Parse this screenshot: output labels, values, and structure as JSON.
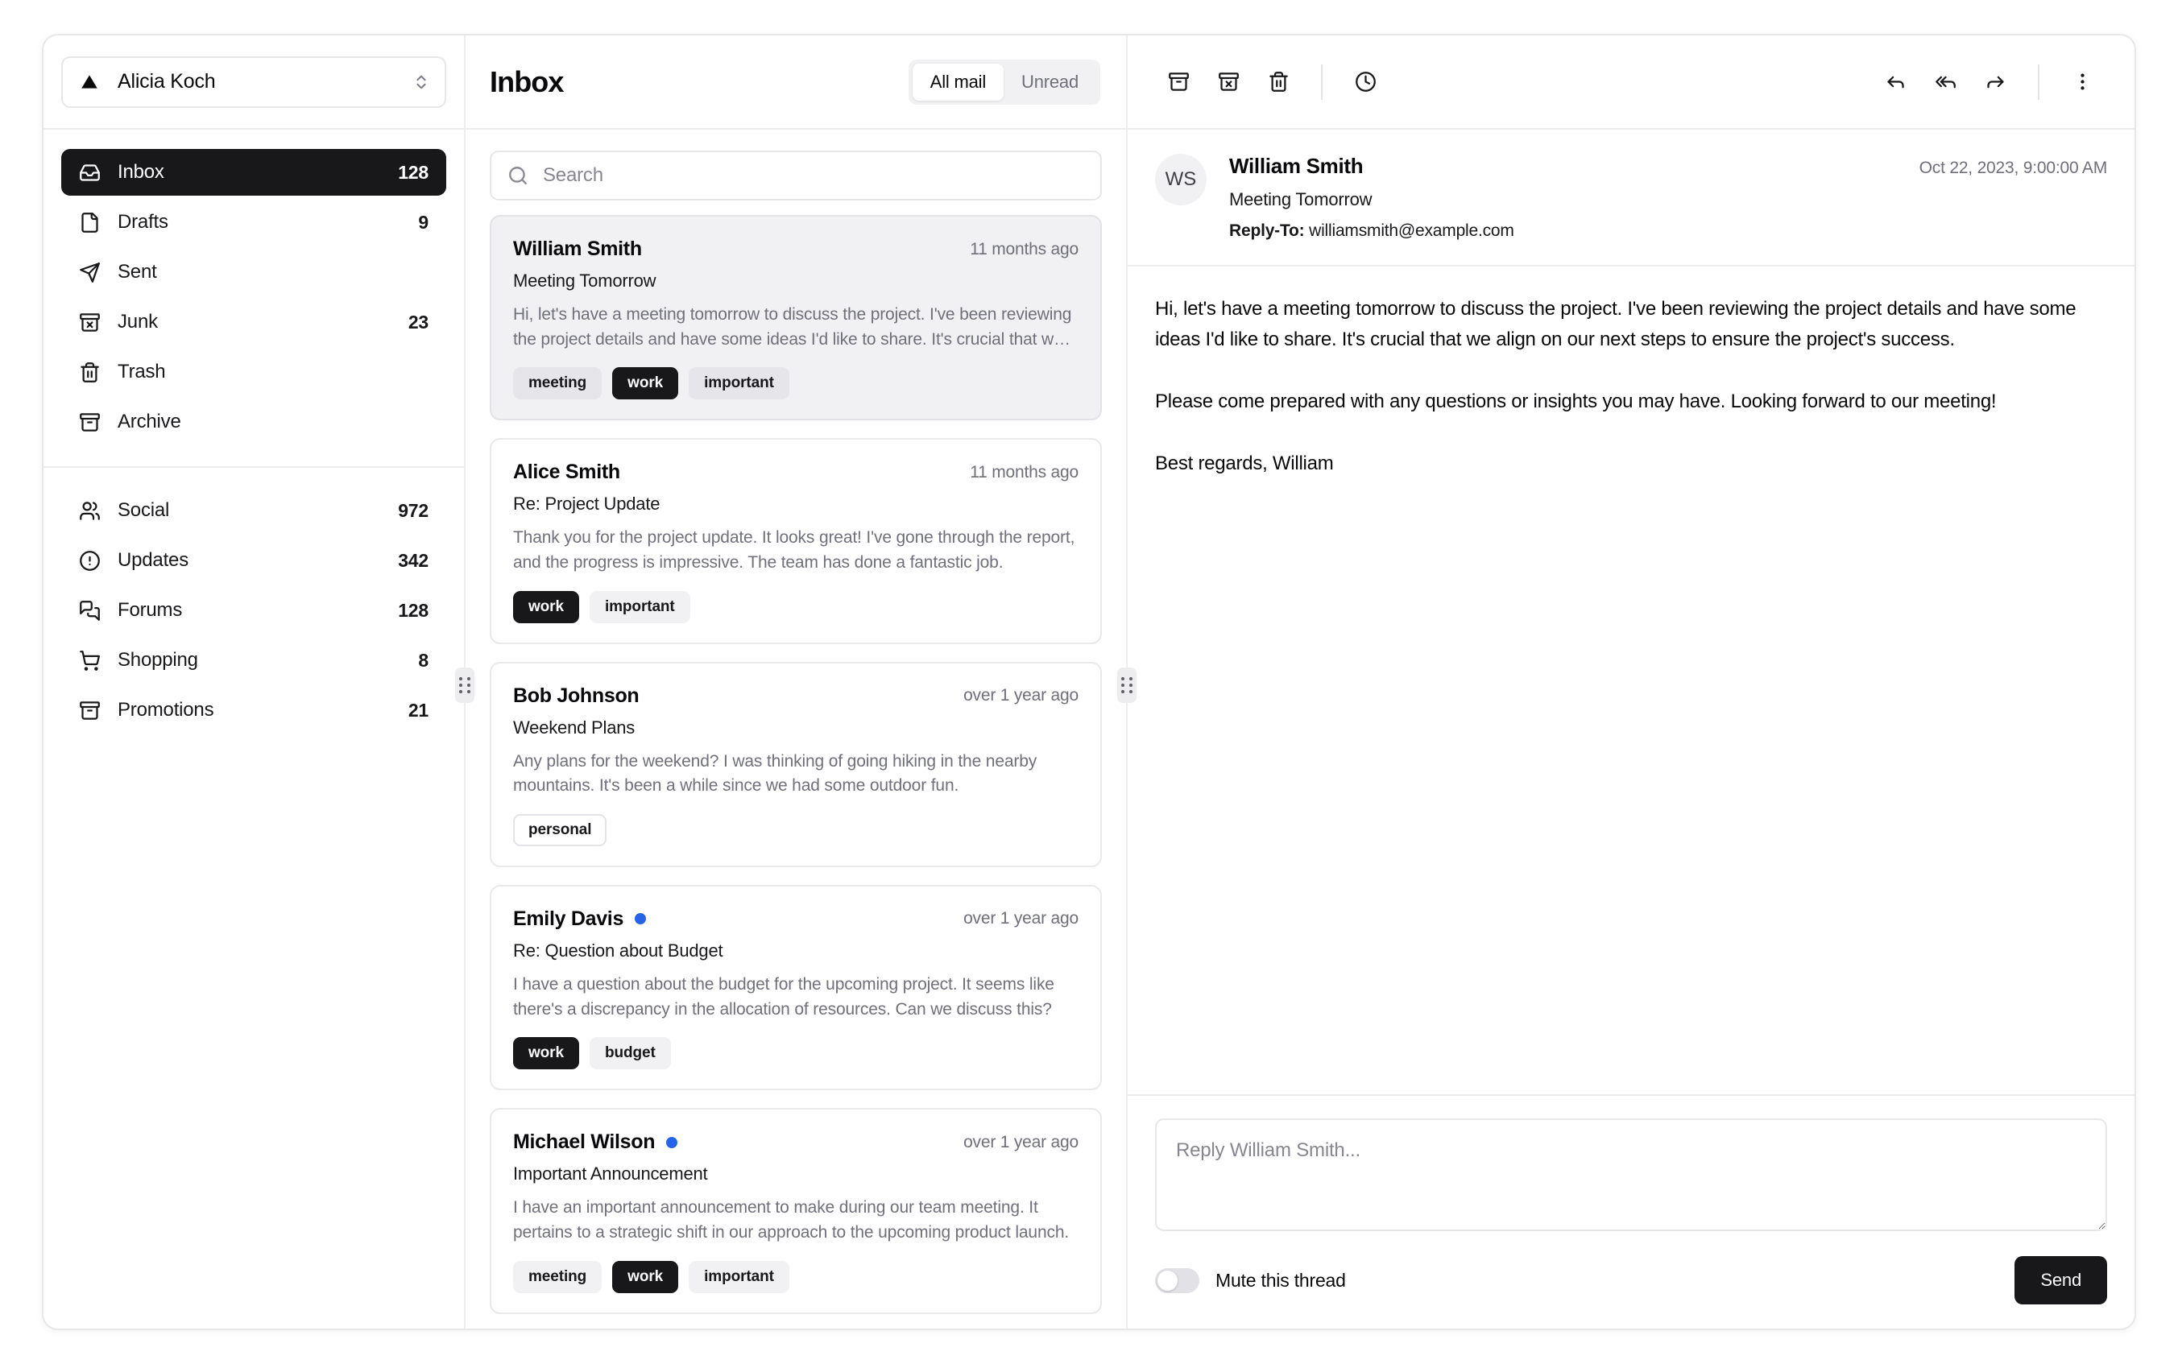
{
  "account": {
    "name": "Alicia Koch",
    "logo_icon": "triangle-logo-icon",
    "switch_icon": "chevrons-up-down-icon"
  },
  "sidebar": {
    "primary_items": [
      {
        "label": "Inbox",
        "count": "128",
        "icon": "inbox-icon",
        "active": true
      },
      {
        "label": "Drafts",
        "count": "9",
        "icon": "file-icon",
        "active": false
      },
      {
        "label": "Sent",
        "count": "",
        "icon": "send-icon",
        "active": false
      },
      {
        "label": "Junk",
        "count": "23",
        "icon": "archive-x-icon",
        "active": false
      },
      {
        "label": "Trash",
        "count": "",
        "icon": "trash-icon",
        "active": false
      },
      {
        "label": "Archive",
        "count": "",
        "icon": "archive-icon",
        "active": false
      }
    ],
    "secondary_items": [
      {
        "label": "Social",
        "count": "972",
        "icon": "users-icon"
      },
      {
        "label": "Updates",
        "count": "342",
        "icon": "alert-circle-icon"
      },
      {
        "label": "Forums",
        "count": "128",
        "icon": "messages-square-icon"
      },
      {
        "label": "Shopping",
        "count": "8",
        "icon": "shopping-cart-icon"
      },
      {
        "label": "Promotions",
        "count": "21",
        "icon": "archive-icon"
      }
    ]
  },
  "maillist": {
    "title": "Inbox",
    "tabs": [
      {
        "label": "All mail",
        "selected": true
      },
      {
        "label": "Unread",
        "selected": false
      }
    ],
    "search": {
      "placeholder": "Search",
      "value": "",
      "icon": "search-icon"
    },
    "items": [
      {
        "name": "William Smith",
        "date": "11 months ago",
        "subject": "Meeting Tomorrow",
        "preview": "Hi, let's have a meeting tomorrow to discuss the project. I've been reviewing the project details and have some ideas I'd like to share. It's crucial that we align on our next steps to ensure the project's success.",
        "unread": false,
        "selected": true,
        "badges": [
          {
            "label": "meeting",
            "variant": "secondary"
          },
          {
            "label": "work",
            "variant": "default"
          },
          {
            "label": "important",
            "variant": "secondary"
          }
        ]
      },
      {
        "name": "Alice Smith",
        "date": "11 months ago",
        "subject": "Re: Project Update",
        "preview": "Thank you for the project update. It looks great! I've gone through the report, and the progress is impressive. The team has done a fantastic job.",
        "unread": false,
        "selected": false,
        "badges": [
          {
            "label": "work",
            "variant": "default"
          },
          {
            "label": "important",
            "variant": "secondary"
          }
        ]
      },
      {
        "name": "Bob Johnson",
        "date": "over 1 year ago",
        "subject": "Weekend Plans",
        "preview": "Any plans for the weekend? I was thinking of going hiking in the nearby mountains. It's been a while since we had some outdoor fun.",
        "unread": false,
        "selected": false,
        "badges": [
          {
            "label": "personal",
            "variant": "outline"
          }
        ]
      },
      {
        "name": "Emily Davis",
        "date": "over 1 year ago",
        "subject": "Re: Question about Budget",
        "preview": "I have a question about the budget for the upcoming project. It seems like there's a discrepancy in the allocation of resources. Can we discuss this?",
        "unread": true,
        "selected": false,
        "badges": [
          {
            "label": "work",
            "variant": "default"
          },
          {
            "label": "budget",
            "variant": "secondary"
          }
        ]
      },
      {
        "name": "Michael Wilson",
        "date": "over 1 year ago",
        "subject": "Important Announcement",
        "preview": "I have an important announcement to make during our team meeting. It pertains to a strategic shift in our approach to the upcoming product launch.",
        "unread": true,
        "selected": false,
        "badges": [
          {
            "label": "meeting",
            "variant": "secondary"
          },
          {
            "label": "work",
            "variant": "default"
          },
          {
            "label": "important",
            "variant": "secondary"
          }
        ]
      }
    ]
  },
  "reader": {
    "toolbar_left": [
      {
        "icon": "archive-icon",
        "name": "archive-button"
      },
      {
        "icon": "archive-x-icon",
        "name": "move-to-junk-button"
      },
      {
        "icon": "trash-icon",
        "name": "move-to-trash-button"
      },
      {
        "icon": "clock-icon",
        "name": "snooze-button"
      }
    ],
    "toolbar_right": [
      {
        "icon": "reply-icon",
        "name": "reply-button"
      },
      {
        "icon": "reply-all-icon",
        "name": "reply-all-button"
      },
      {
        "icon": "forward-icon",
        "name": "forward-button"
      },
      {
        "icon": "more-vertical-icon",
        "name": "more-options-button"
      }
    ],
    "message": {
      "avatar_initials": "WS",
      "sender": "William Smith",
      "subject": "Meeting Tomorrow",
      "reply_to_label": "Reply-To:",
      "reply_to_email": "williamsmith@example.com",
      "date": "Oct 22, 2023, 9:00:00 AM",
      "body": "Hi, let's have a meeting tomorrow to discuss the project. I've been reviewing the project details and have some ideas I'd like to share. It's crucial that we align on our next steps to ensure the project's success.\n\nPlease come prepared with any questions or insights you may have. Looking forward to our meeting!\n\nBest regards, William"
    },
    "composer": {
      "reply_placeholder": "Reply William Smith...",
      "reply_value": "",
      "mute_label": "Mute this thread",
      "mute_on": false,
      "send_label": "Send"
    }
  },
  "colors": {
    "accent": "#18181b",
    "unread_dot": "#2563eb",
    "muted_text": "#70707b",
    "border": "#e7e7e9",
    "selected_bg": "#f1f1f3"
  }
}
